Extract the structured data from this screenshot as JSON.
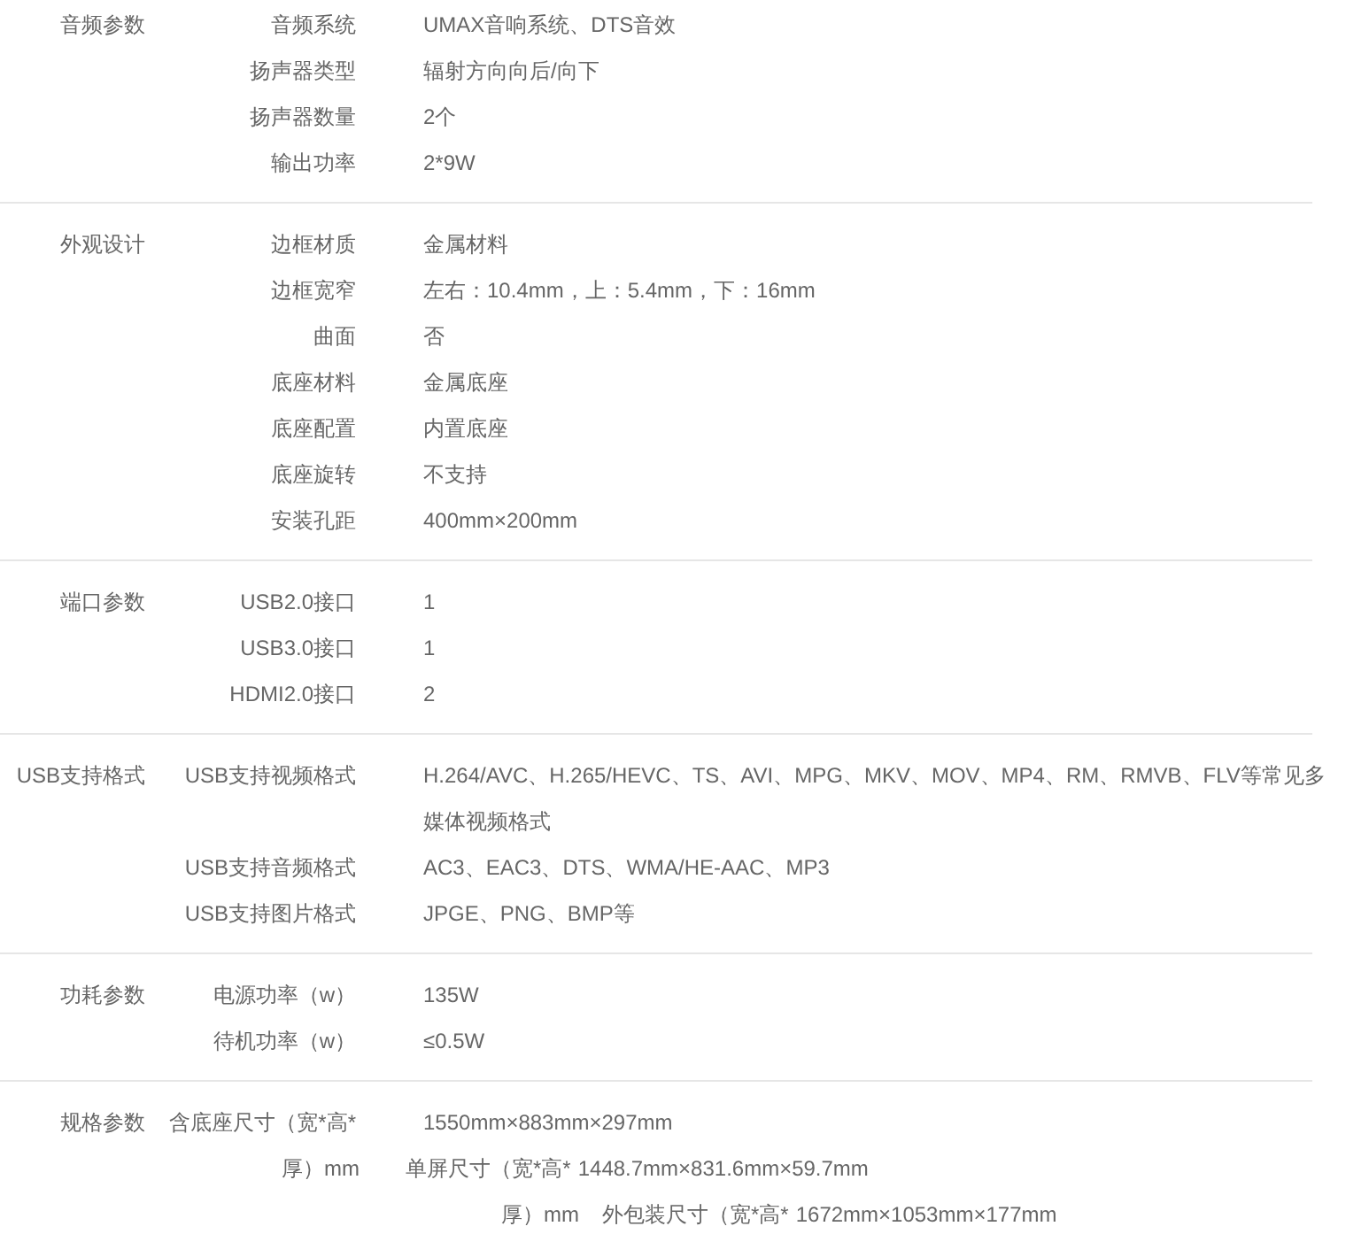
{
  "groups": [
    {
      "title": "音频参数",
      "rows": [
        {
          "label": "音频系统",
          "value": "UMAX音响系统、DTS音效"
        },
        {
          "label": "扬声器类型",
          "value": "辐射方向向后/向下"
        },
        {
          "label": "扬声器数量",
          "value": "2个"
        },
        {
          "label": "输出功率",
          "value": "2*9W"
        }
      ]
    },
    {
      "title": "外观设计",
      "rows": [
        {
          "label": "边框材质",
          "value": "金属材料"
        },
        {
          "label": "边框宽窄",
          "value": "左右：10.4mm，上：5.4mm，下：16mm"
        },
        {
          "label": "曲面",
          "value": "否"
        },
        {
          "label": "底座材料",
          "value": "金属底座"
        },
        {
          "label": "底座配置",
          "value": "内置底座"
        },
        {
          "label": "底座旋转",
          "value": "不支持"
        },
        {
          "label": "安装孔距",
          "value": "400mm×200mm"
        }
      ]
    },
    {
      "title": "端口参数",
      "rows": [
        {
          "label": "USB2.0接口",
          "value": "1"
        },
        {
          "label": "USB3.0接口",
          "value": "1"
        },
        {
          "label": "HDMI2.0接口",
          "value": "2"
        }
      ]
    },
    {
      "title": "USB支持格式",
      "rows": [
        {
          "label": "USB支持视频格式",
          "value": "H.264/AVC、H.265/HEVC、TS、AVI、MPG、MKV、MOV、MP4、RM、RMVB、FLV等常见多媒体视频格式"
        },
        {
          "label": "USB支持音频格式",
          "value": "AC3、EAC3、DTS、WMA/HE-AAC、MP3"
        },
        {
          "label": "USB支持图片格式",
          "value": "JPGE、PNG、BMP等"
        }
      ]
    },
    {
      "title": "功耗参数",
      "rows": [
        {
          "label": "电源功率（w）",
          "value": "135W"
        },
        {
          "label": "待机功率（w）",
          "value": "≤0.5W"
        }
      ]
    },
    {
      "title": "规格参数",
      "kind": "flow",
      "lines": [
        {
          "pieces": [
            {
              "text": "含底座尺寸（宽*高*"
            },
            {
              "text": "1550mm×883mm×297mm"
            }
          ]
        },
        {
          "pieces": [
            {
              "text": "厚）mm"
            },
            {
              "text": "单屏尺寸（宽*高*"
            },
            {
              "text": "1448.7mm×831.6mm×59.7mm"
            }
          ]
        },
        {
          "pieces": [
            {
              "text": "厚）mm"
            },
            {
              "text": "外包装尺寸（宽*高*"
            },
            {
              "text": "1672mm×1053mm×177mm"
            }
          ]
        }
      ]
    }
  ]
}
